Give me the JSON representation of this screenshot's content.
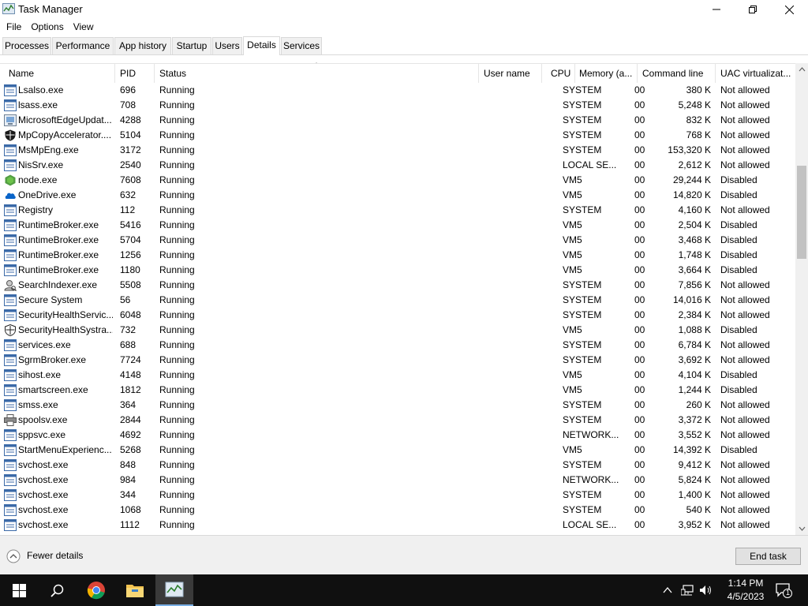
{
  "window": {
    "title": "Task Manager",
    "app_icon": "task-manager-icon",
    "controls": [
      "minimize-icon",
      "restore-icon",
      "close-icon"
    ]
  },
  "menu": [
    "File",
    "Options",
    "View"
  ],
  "tabs": [
    {
      "label": "Processes",
      "active": false
    },
    {
      "label": "Performance",
      "active": false
    },
    {
      "label": "App history",
      "active": false
    },
    {
      "label": "Startup",
      "active": false
    },
    {
      "label": "Users",
      "active": false
    },
    {
      "label": "Details",
      "active": true
    },
    {
      "label": "Services",
      "active": false
    }
  ],
  "columns": {
    "name": "Name",
    "pid": "PID",
    "status": "Status",
    "user": "User name",
    "cpu": "CPU",
    "memory": "Memory (a...",
    "command": "Command line",
    "uac": "UAC virtualizat..."
  },
  "rows": [
    {
      "icon": "app-window-icon",
      "name": "Lsalso.exe",
      "pid": "696",
      "status": "Running",
      "user": "SYSTEM",
      "cpu": "00",
      "memory": "380 K",
      "uac": "Not allowed"
    },
    {
      "icon": "app-window-icon",
      "name": "lsass.exe",
      "pid": "708",
      "status": "Running",
      "user": "SYSTEM",
      "cpu": "00",
      "memory": "5,248 K",
      "uac": "Not allowed"
    },
    {
      "icon": "installer-icon",
      "name": "MicrosoftEdgeUpdat...",
      "pid": "4288",
      "status": "Running",
      "user": "SYSTEM",
      "cpu": "00",
      "memory": "832 K",
      "uac": "Not allowed"
    },
    {
      "icon": "shield-dark-icon",
      "name": "MpCopyAccelerator....",
      "pid": "5104",
      "status": "Running",
      "user": "SYSTEM",
      "cpu": "00",
      "memory": "768 K",
      "uac": "Not allowed"
    },
    {
      "icon": "app-window-icon",
      "name": "MsMpEng.exe",
      "pid": "3172",
      "status": "Running",
      "user": "SYSTEM",
      "cpu": "00",
      "memory": "153,320 K",
      "uac": "Not allowed"
    },
    {
      "icon": "app-window-icon",
      "name": "NisSrv.exe",
      "pid": "2540",
      "status": "Running",
      "user": "LOCAL SE...",
      "cpu": "00",
      "memory": "2,612 K",
      "uac": "Not allowed"
    },
    {
      "icon": "nodejs-icon",
      "name": "node.exe",
      "pid": "7608",
      "status": "Running",
      "user": "VM5",
      "cpu": "00",
      "memory": "29,244 K",
      "uac": "Disabled"
    },
    {
      "icon": "onedrive-icon",
      "name": "OneDrive.exe",
      "pid": "632",
      "status": "Running",
      "user": "VM5",
      "cpu": "00",
      "memory": "14,820 K",
      "uac": "Disabled"
    },
    {
      "icon": "app-window-icon",
      "name": "Registry",
      "pid": "112",
      "status": "Running",
      "user": "SYSTEM",
      "cpu": "00",
      "memory": "4,160 K",
      "uac": "Not allowed"
    },
    {
      "icon": "app-window-icon",
      "name": "RuntimeBroker.exe",
      "pid": "5416",
      "status": "Running",
      "user": "VM5",
      "cpu": "00",
      "memory": "2,504 K",
      "uac": "Disabled"
    },
    {
      "icon": "app-window-icon",
      "name": "RuntimeBroker.exe",
      "pid": "5704",
      "status": "Running",
      "user": "VM5",
      "cpu": "00",
      "memory": "3,468 K",
      "uac": "Disabled"
    },
    {
      "icon": "app-window-icon",
      "name": "RuntimeBroker.exe",
      "pid": "1256",
      "status": "Running",
      "user": "VM5",
      "cpu": "00",
      "memory": "1,748 K",
      "uac": "Disabled"
    },
    {
      "icon": "app-window-icon",
      "name": "RuntimeBroker.exe",
      "pid": "1180",
      "status": "Running",
      "user": "VM5",
      "cpu": "00",
      "memory": "3,664 K",
      "uac": "Disabled"
    },
    {
      "icon": "search-indexer-icon",
      "name": "SearchIndexer.exe",
      "pid": "5508",
      "status": "Running",
      "user": "SYSTEM",
      "cpu": "00",
      "memory": "7,856 K",
      "uac": "Not allowed"
    },
    {
      "icon": "app-window-icon",
      "name": "Secure System",
      "pid": "56",
      "status": "Running",
      "user": "SYSTEM",
      "cpu": "00",
      "memory": "14,016 K",
      "uac": "Not allowed"
    },
    {
      "icon": "app-window-icon",
      "name": "SecurityHealthServic...",
      "pid": "6048",
      "status": "Running",
      "user": "SYSTEM",
      "cpu": "00",
      "memory": "2,384 K",
      "uac": "Not allowed"
    },
    {
      "icon": "shield-outline-icon",
      "name": "SecurityHealthSystra...",
      "pid": "732",
      "status": "Running",
      "user": "VM5",
      "cpu": "00",
      "memory": "1,088 K",
      "uac": "Disabled"
    },
    {
      "icon": "app-window-icon",
      "name": "services.exe",
      "pid": "688",
      "status": "Running",
      "user": "SYSTEM",
      "cpu": "00",
      "memory": "6,784 K",
      "uac": "Not allowed"
    },
    {
      "icon": "app-window-icon",
      "name": "SgrmBroker.exe",
      "pid": "7724",
      "status": "Running",
      "user": "SYSTEM",
      "cpu": "00",
      "memory": "3,692 K",
      "uac": "Not allowed"
    },
    {
      "icon": "app-window-icon",
      "name": "sihost.exe",
      "pid": "4148",
      "status": "Running",
      "user": "VM5",
      "cpu": "00",
      "memory": "4,104 K",
      "uac": "Disabled"
    },
    {
      "icon": "app-window-icon",
      "name": "smartscreen.exe",
      "pid": "1812",
      "status": "Running",
      "user": "VM5",
      "cpu": "00",
      "memory": "1,244 K",
      "uac": "Disabled"
    },
    {
      "icon": "app-window-icon",
      "name": "smss.exe",
      "pid": "364",
      "status": "Running",
      "user": "SYSTEM",
      "cpu": "00",
      "memory": "260 K",
      "uac": "Not allowed"
    },
    {
      "icon": "printer-icon",
      "name": "spoolsv.exe",
      "pid": "2844",
      "status": "Running",
      "user": "SYSTEM",
      "cpu": "00",
      "memory": "3,372 K",
      "uac": "Not allowed"
    },
    {
      "icon": "app-window-icon",
      "name": "sppsvc.exe",
      "pid": "4692",
      "status": "Running",
      "user": "NETWORK...",
      "cpu": "00",
      "memory": "3,552 K",
      "uac": "Not allowed"
    },
    {
      "icon": "app-window-icon",
      "name": "StartMenuExperienc...",
      "pid": "5268",
      "status": "Running",
      "user": "VM5",
      "cpu": "00",
      "memory": "14,392 K",
      "uac": "Disabled"
    },
    {
      "icon": "app-window-icon",
      "name": "svchost.exe",
      "pid": "848",
      "status": "Running",
      "user": "SYSTEM",
      "cpu": "00",
      "memory": "9,412 K",
      "uac": "Not allowed"
    },
    {
      "icon": "app-window-icon",
      "name": "svchost.exe",
      "pid": "984",
      "status": "Running",
      "user": "NETWORK...",
      "cpu": "00",
      "memory": "5,824 K",
      "uac": "Not allowed"
    },
    {
      "icon": "app-window-icon",
      "name": "svchost.exe",
      "pid": "344",
      "status": "Running",
      "user": "SYSTEM",
      "cpu": "00",
      "memory": "1,400 K",
      "uac": "Not allowed"
    },
    {
      "icon": "app-window-icon",
      "name": "svchost.exe",
      "pid": "1068",
      "status": "Running",
      "user": "SYSTEM",
      "cpu": "00",
      "memory": "540 K",
      "uac": "Not allowed"
    },
    {
      "icon": "app-window-icon",
      "name": "svchost.exe",
      "pid": "1112",
      "status": "Running",
      "user": "LOCAL SE...",
      "cpu": "00",
      "memory": "3,952 K",
      "uac": "Not allowed"
    }
  ],
  "footer": {
    "fewer_details": "Fewer details",
    "end_task": "End task"
  },
  "taskbar": {
    "items": [
      "windows-start-icon",
      "search-icon",
      "chrome-icon",
      "file-explorer-icon",
      "task-manager-icon"
    ],
    "tray": [
      "chevron-up-icon",
      "network-icon",
      "volume-icon"
    ],
    "time": "1:14 PM",
    "date": "4/5/2023",
    "notification_count": "1"
  },
  "colors": {
    "accent": "#0078d7",
    "taskbar": "#101010",
    "selected_tab_border": "#d9d9d9"
  }
}
